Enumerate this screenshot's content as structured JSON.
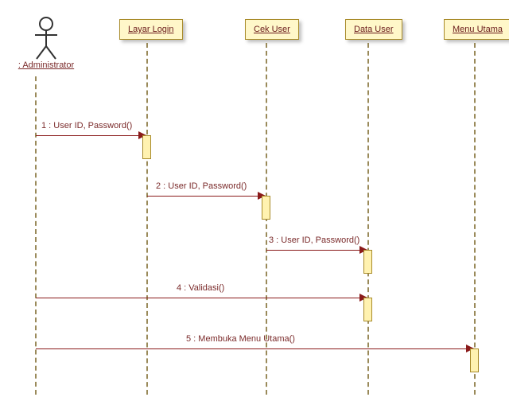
{
  "diagram": {
    "type": "uml-sequence",
    "actor": {
      "label": ": Administrator"
    },
    "lifelines": [
      {
        "id": "layar_login",
        "label": "Layar Login"
      },
      {
        "id": "cek_user",
        "label": "Cek User"
      },
      {
        "id": "data_user",
        "label": "Data User"
      },
      {
        "id": "menu_utama",
        "label": "Menu Utama"
      }
    ],
    "messages": [
      {
        "n": 1,
        "label": "1 : User ID, Password()",
        "from": "actor",
        "to": "layar_login"
      },
      {
        "n": 2,
        "label": "2 : User ID, Password()",
        "from": "layar_login",
        "to": "cek_user"
      },
      {
        "n": 3,
        "label": "3 : User ID, Password()",
        "from": "cek_user",
        "to": "data_user"
      },
      {
        "n": 4,
        "label": "4 : Validasi()",
        "from": "actor",
        "to": "data_user"
      },
      {
        "n": 5,
        "label": "5 : Membuka Menu Utama()",
        "from": "actor",
        "to": "menu_utama"
      }
    ]
  },
  "colors": {
    "stroke": "#8a1a1a",
    "box_fill": "#fff7c9",
    "box_border": "#a88b2a",
    "lifeline": "#9a8a5a"
  }
}
